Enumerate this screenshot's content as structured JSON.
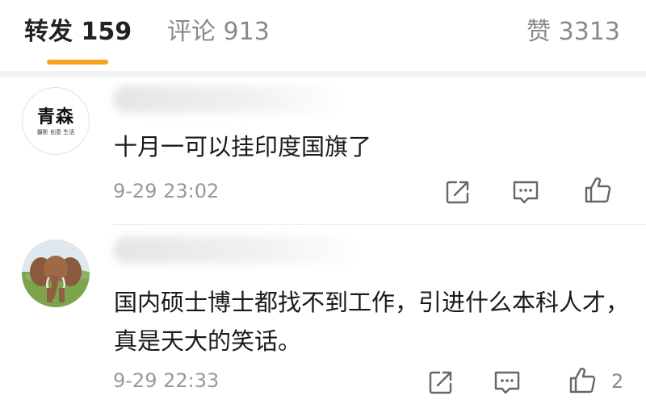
{
  "tabs": {
    "reposts": "转发 159",
    "comments": "评论 913",
    "likes": "赞 3313"
  },
  "accent_color": "#f7a21b",
  "comments": [
    {
      "avatar": {
        "text": "青森",
        "subtext": "摄影 创意 生活"
      },
      "text": "十月一可以挂印度国旗了",
      "time": "9-29 23:02",
      "like_count": ""
    },
    {
      "avatar": {
        "icon": "elephant-avatar"
      },
      "text": "国内硕士博士都找不到工作，引进什么本科人才，真是天大的笑话。",
      "time": "9-29 22:33",
      "like_count": "2"
    }
  ]
}
